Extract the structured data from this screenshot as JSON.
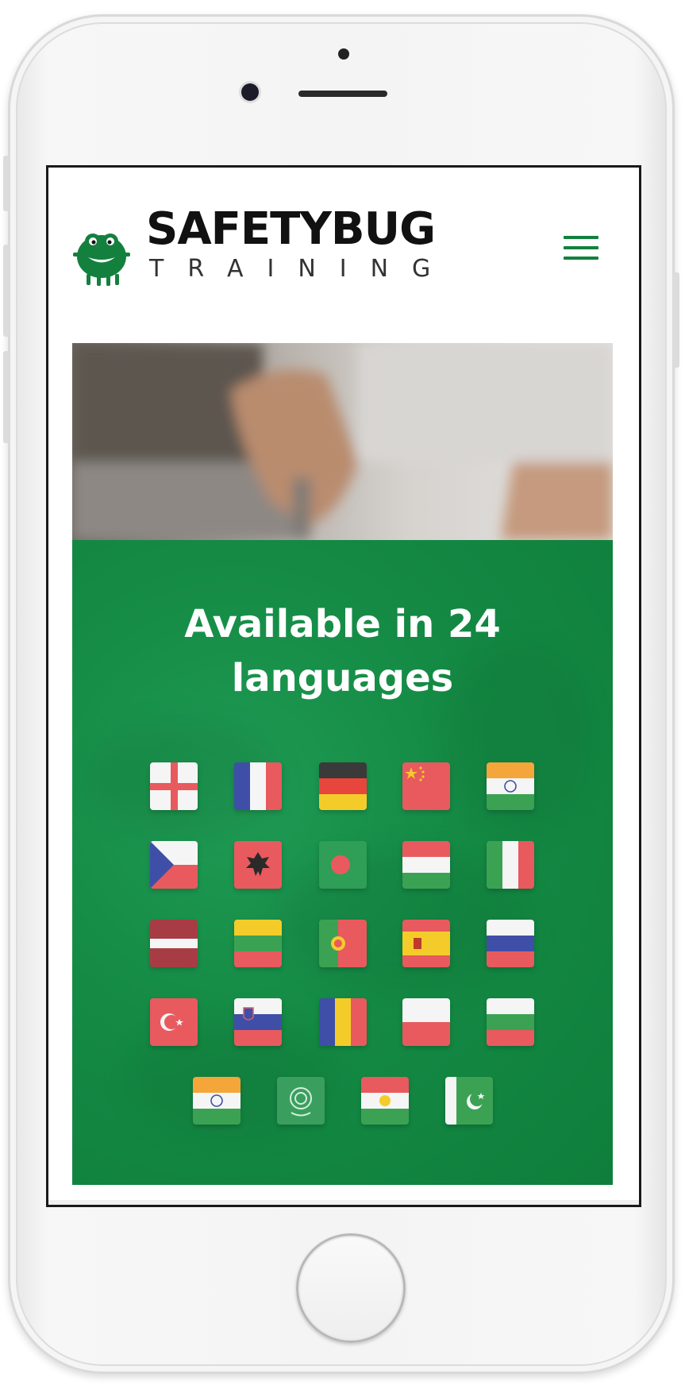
{
  "brand": {
    "name": "SAFETYBUG",
    "tagline": "TRAINING",
    "color": "#13803e"
  },
  "hero": {
    "headline": "Available in 24\nlanguages",
    "panel_color": "#148a44"
  },
  "languages": {
    "count": 24,
    "flags": [
      "england-flag",
      "france-flag",
      "germany-flag",
      "china-flag",
      "india-flag",
      "czech-republic-flag",
      "albania-flag",
      "bangladesh-flag",
      "hungary-flag",
      "italy-flag",
      "latvia-flag",
      "lithuania-flag",
      "portugal-flag",
      "spain-flag",
      "russia-flag",
      "turkey-flag",
      "slovenia-flag",
      "romania-flag",
      "poland-flag",
      "bulgaria-flag",
      "india-flag",
      "arab-league-flag",
      "kurdistan-flag",
      "pakistan-flag"
    ]
  },
  "icons": {
    "menu": "hamburger-menu-icon",
    "logo": "bug-mascot-icon"
  }
}
